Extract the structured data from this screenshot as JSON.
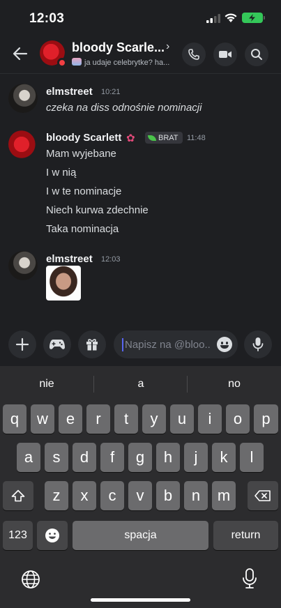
{
  "status": {
    "time": "12:03"
  },
  "header": {
    "title": "bloody Scarle...",
    "subtitle": "ja udaje celebrytke? ha..."
  },
  "messages": [
    {
      "author": "elmstreet",
      "time": "10:21",
      "lines": [
        "czeka na diss odnośnie nominacji"
      ]
    },
    {
      "author": "bloody Scarlett",
      "time": "11:48",
      "badge": "BRAT",
      "lines": [
        "Mam wyjebane",
        "I w nią",
        "I w te nominacje",
        "Niech kurwa zdechnie",
        "Taka nominacja"
      ]
    },
    {
      "author": "elmstreet",
      "time": "12:03",
      "lines": []
    }
  ],
  "composer": {
    "placeholder": "Napisz na @bloo..."
  },
  "keyboard": {
    "suggestions": [
      "nie",
      "a",
      "no"
    ],
    "row1": [
      "q",
      "w",
      "e",
      "r",
      "t",
      "y",
      "u",
      "i",
      "o",
      "p"
    ],
    "row2": [
      "a",
      "s",
      "d",
      "f",
      "g",
      "h",
      "j",
      "k",
      "l"
    ],
    "row3": [
      "z",
      "x",
      "c",
      "v",
      "b",
      "n",
      "m"
    ],
    "numbers_label": "123",
    "space_label": "spacja",
    "return_label": "return"
  },
  "colors": {
    "background": "#1e1f22",
    "accent": "#5865f2",
    "dnd": "#f23f43",
    "battery": "#34c759"
  }
}
